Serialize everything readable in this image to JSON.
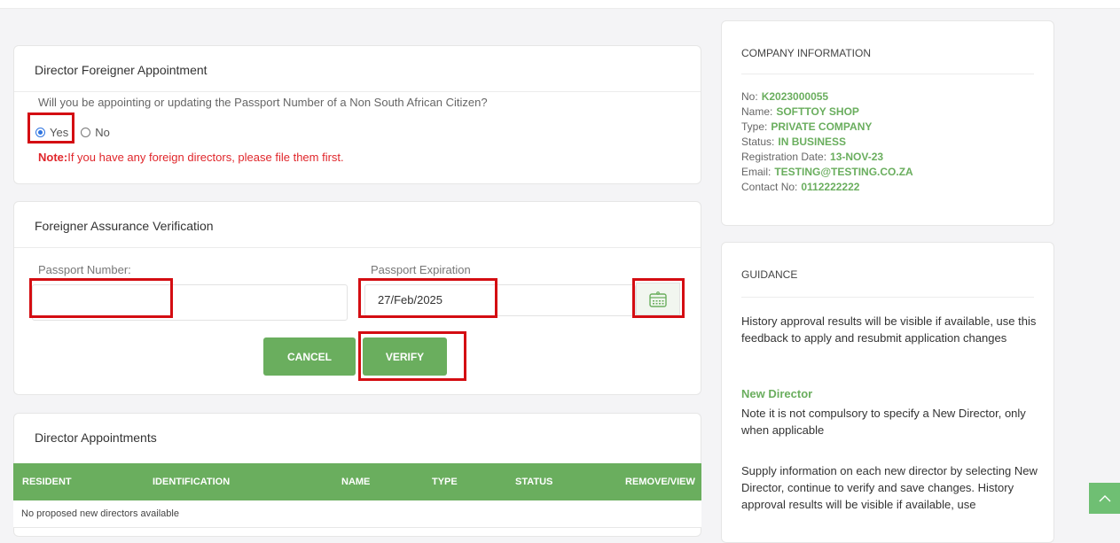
{
  "director_foreigner": {
    "title": "Director Foreigner Appointment",
    "question": "Will you be appointing or updating the Passport Number of a Non South African Citizen?",
    "option_yes": "Yes",
    "option_no": "No",
    "selected": "Yes",
    "note_label": "Note:",
    "note_text": "If you have any foreign directors, please file them first."
  },
  "assurance": {
    "title": "Foreigner Assurance Verification",
    "passport_number_label": "Passport Number:",
    "passport_number_value": "",
    "passport_expiration_label": "Passport Expiration",
    "passport_expiration_value": "27/Feb/2025",
    "cancel_label": "CANCEL",
    "verify_label": "VERIFY"
  },
  "appointments": {
    "title": "Director Appointments",
    "columns": [
      "RESIDENT",
      "IDENTIFICATION",
      "NAME",
      "TYPE",
      "STATUS",
      "REMOVE/VIEW"
    ],
    "empty_message": "No proposed new directors available"
  },
  "company": {
    "title": "COMPANY INFORMATION",
    "rows": [
      {
        "label": "No:",
        "value": "K2023000055"
      },
      {
        "label": "Name:",
        "value": "SOFTTOY SHOP"
      },
      {
        "label": "Type:",
        "value": "PRIVATE COMPANY"
      },
      {
        "label": "Status:",
        "value": "IN BUSINESS"
      },
      {
        "label": "Registration Date:",
        "value": "13-NOV-23"
      },
      {
        "label": "Email:",
        "value": "TESTING@TESTING.CO.ZA"
      },
      {
        "label": "Contact No:",
        "value": "0112222222"
      }
    ]
  },
  "guidance": {
    "title": "GUIDANCE",
    "para1": "History approval results will be visible if available, use this feedback to apply and resubmit application changes",
    "subheading": "New Director",
    "para2": "Note it is not compulsory to specify a New Director, only when applicable",
    "para3": "Supply information on each new director by selecting New Director, continue to verify and save changes. History approval results will be visible if available, use"
  },
  "colors": {
    "accent": "#6aae5e",
    "highlight": "#d40d12",
    "note": "#e0262b"
  },
  "icons": {
    "calendar": "calendar-icon",
    "scroll_top": "chevron-up-icon"
  }
}
